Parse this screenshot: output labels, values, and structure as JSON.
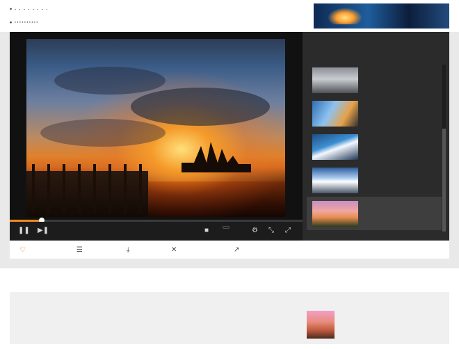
{
  "header": {
    "nav_line_1": "• · · · · · · · ·",
    "nav_line_2": "• ··········",
    "ad_text": "",
    "ad_sub": ""
  },
  "player": {
    "overlay_line_1": "",
    "overlay_line_2": "",
    "overlay_line_3": "",
    "watermark": "",
    "time": "",
    "quality": "",
    "progress_fraction": 0.11,
    "controls": {
      "play_icon": "❚❚",
      "next_icon": "▶❚",
      "volume_icon": "■",
      "settings_icon": "⚙",
      "fullscreen_icon": "⤢",
      "expand_icon": "⤡"
    }
  },
  "playlist": {
    "title": "",
    "subtitle": "",
    "items": [
      {
        "title": "",
        "meta": "",
        "active": false
      },
      {
        "title": "",
        "meta": "",
        "active": false
      },
      {
        "title": "",
        "meta": "",
        "active": false
      },
      {
        "title": "",
        "meta": "",
        "active": false
      },
      {
        "title": "",
        "meta": "",
        "active": true
      }
    ]
  },
  "actionbar": {
    "favorite": "",
    "comment": "",
    "download": "",
    "share": "",
    "embed": "",
    "more": ""
  },
  "info": {
    "heading": "",
    "uploader": "",
    "desc_line_1": "",
    "desc_line_2": "",
    "related_label": "",
    "related_meta": ""
  },
  "colors": {
    "accent": "#f08a24",
    "link": "#2a66b5",
    "player_bg": "#111111",
    "playlist_bg": "#2b2b2b",
    "band_bg": "#e9e9e9"
  }
}
